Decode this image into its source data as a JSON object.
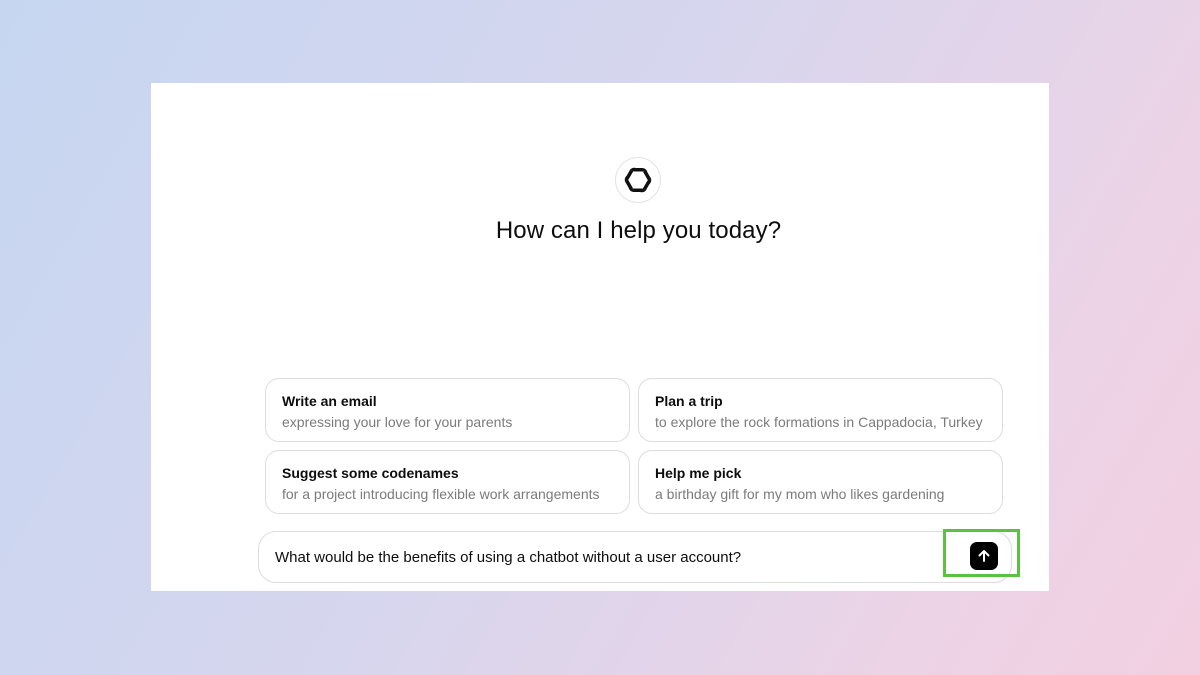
{
  "header": {
    "logo_icon": "openai-logo-icon",
    "title": "How can I help you today?"
  },
  "suggestions": [
    {
      "title": "Write an email",
      "subtitle": "expressing your love for your parents"
    },
    {
      "title": "Plan a trip",
      "subtitle": "to explore the rock formations in Cappadocia, Turkey"
    },
    {
      "title": "Suggest some codenames",
      "subtitle": "for a project introducing flexible work arrangements"
    },
    {
      "title": "Help me pick",
      "subtitle": "a birthday gift for my mom who likes gardening"
    }
  ],
  "composer": {
    "value": "What would be the benefits of using a chatbot without a user account?",
    "send_icon": "arrow-up-icon"
  },
  "colors": {
    "highlight": "#5ac142",
    "send_button": "#000000"
  }
}
